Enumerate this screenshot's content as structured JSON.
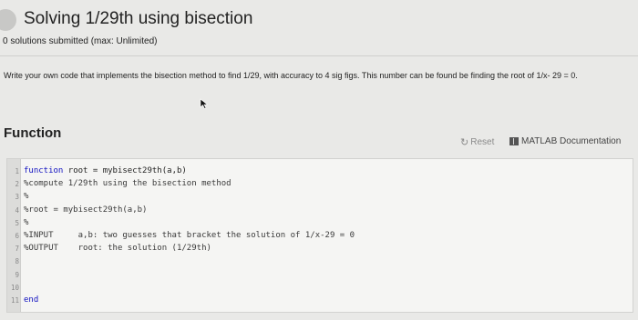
{
  "header": {
    "title": "Solving 1/29th using bisection",
    "subtitle": "0 solutions submitted (max: Unlimited)"
  },
  "problem": {
    "text": "Write your own code that implements the bisection method to find 1/29, with accuracy to 4 sig figs. This number can be found be finding the root of 1/x- 29 = 0."
  },
  "function_section": {
    "title": "Function",
    "reset_label": "Reset",
    "docs_label": "MATLAB Documentation"
  },
  "editor": {
    "lines": [
      {
        "num": "1",
        "keyword": "function",
        "text": " root = mybisect29th(a,b)"
      },
      {
        "num": "2",
        "keyword": "",
        "text": "%compute 1/29th using the bisection method"
      },
      {
        "num": "3",
        "keyword": "",
        "text": "%"
      },
      {
        "num": "4",
        "keyword": "",
        "text": "%root = mybisect29th(a,b)"
      },
      {
        "num": "5",
        "keyword": "",
        "text": "%"
      },
      {
        "num": "6",
        "keyword": "",
        "text": "%INPUT     a,b: two guesses that bracket the solution of 1/x-29 = 0"
      },
      {
        "num": "7",
        "keyword": "",
        "text": "%OUTPUT    root: the solution (1/29th)"
      },
      {
        "num": "8",
        "keyword": "",
        "text": ""
      },
      {
        "num": "9",
        "keyword": "",
        "text": ""
      },
      {
        "num": "10",
        "keyword": "",
        "text": ""
      },
      {
        "num": "11",
        "keyword": "end",
        "text": ""
      }
    ]
  }
}
